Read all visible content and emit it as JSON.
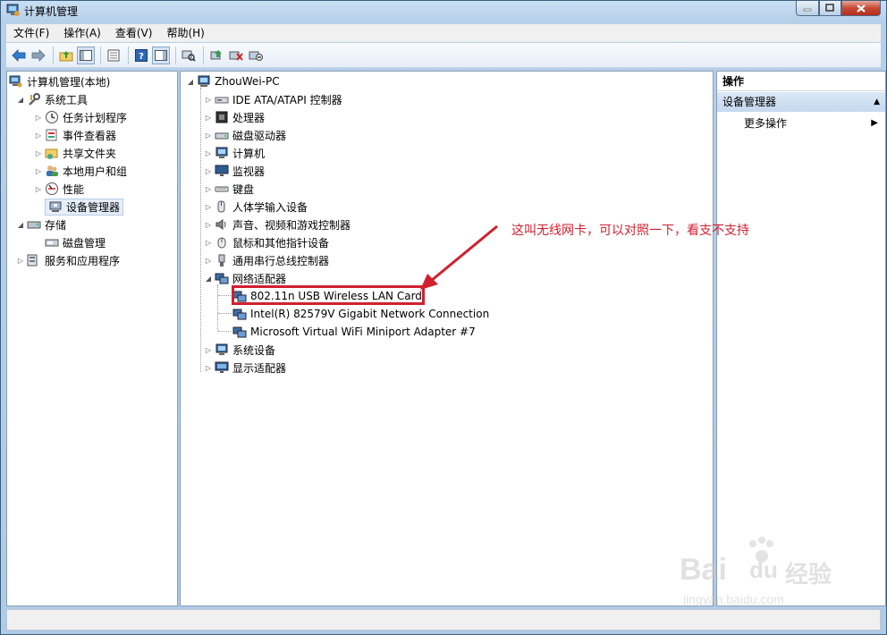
{
  "window": {
    "title": "计算机管理"
  },
  "menu": [
    "文件(F)",
    "操作(A)",
    "查看(V)",
    "帮助(H)"
  ],
  "toolbar_icons": [
    "back-icon",
    "forward-icon",
    "up-folder-icon",
    "show-hide-tree-icon",
    "export-list-icon",
    "help-icon",
    "show-hide-action-icon",
    "scan-hardware-icon",
    "update-driver-icon",
    "uninstall-icon",
    "disable-device-icon"
  ],
  "left_tree": [
    {
      "label": "计算机管理(本地)",
      "icon": "computer-management-icon"
    },
    {
      "label": "系统工具",
      "icon": "system-tools-icon"
    },
    {
      "label": "任务计划程序",
      "icon": "clock-icon"
    },
    {
      "label": "事件查看器",
      "icon": "event-viewer-icon"
    },
    {
      "label": "共享文件夹",
      "icon": "shared-folder-icon"
    },
    {
      "label": "本地用户和组",
      "icon": "users-icon"
    },
    {
      "label": "性能",
      "icon": "performance-icon"
    },
    {
      "label": "设备管理器",
      "icon": "device-manager-icon"
    },
    {
      "label": "存储",
      "icon": "storage-icon"
    },
    {
      "label": "磁盘管理",
      "icon": "disk-icon"
    },
    {
      "label": "服务和应用程序",
      "icon": "services-icon"
    }
  ],
  "device_tree": {
    "root": "ZhouWei-PC",
    "categories": [
      "IDE ATA/ATAPI 控制器",
      "处理器",
      "磁盘驱动器",
      "计算机",
      "监视器",
      "键盘",
      "人体学输入设备",
      "声音、视频和游戏控制器",
      "鼠标和其他指针设备",
      "通用串行总线控制器",
      "网络适配器",
      "系统设备",
      "显示适配器"
    ],
    "network_children": [
      "802.11n USB Wireless LAN Card",
      "Intel(R) 82579V Gigabit Network Connection",
      "Microsoft Virtual WiFi Miniport Adapter #7"
    ]
  },
  "actions": {
    "header": "操作",
    "section": "设备管理器",
    "more": "更多操作"
  },
  "annotation": "这叫无线网卡，可以对照一下，看支不支持",
  "watermark": {
    "brand": "Bai",
    "brand2": "du",
    "cn": "经验",
    "url": "jingyan.baidu.com"
  },
  "colors": {
    "annotation": "#d2202f",
    "titlebar": "#b7d0ea",
    "selection": "#e5eef9"
  }
}
